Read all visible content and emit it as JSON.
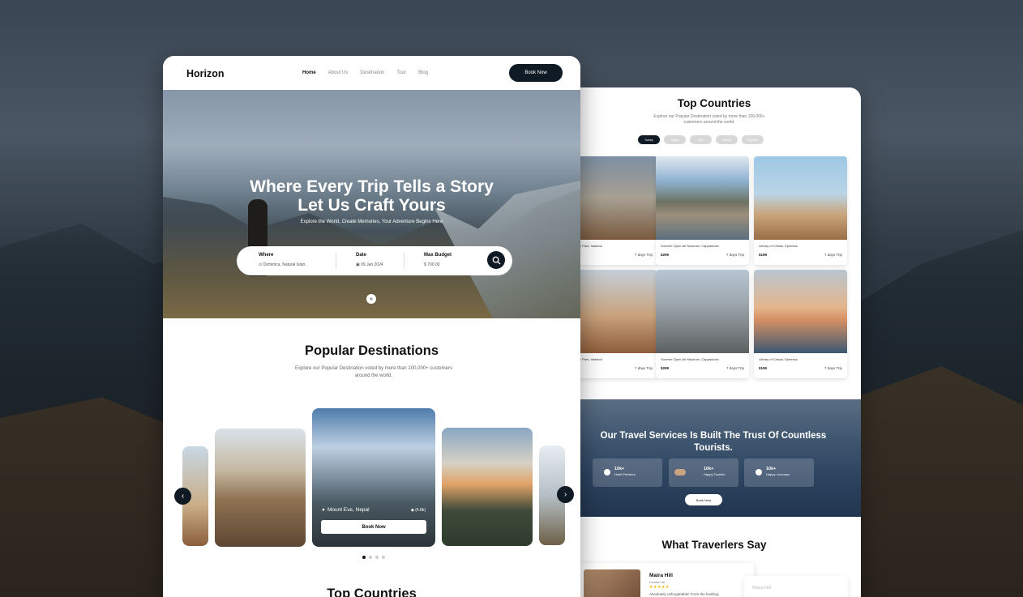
{
  "nav": {
    "logo": "Horizon",
    "links": [
      "Home",
      "About Us",
      "Destination",
      "Tour",
      "Blog"
    ],
    "cta": "Book Now"
  },
  "hero": {
    "title_line1": "Where Every Trip Tells a Story",
    "title_line2": "Let Us Craft Yours",
    "subtitle": "Explore the World, Create Memories, Your Adventure Begins Here",
    "search": {
      "where_label": "Where",
      "where_value": "Dominica, Natural Islan..",
      "date_label": "Date",
      "date_value": "09 Jan 2024",
      "budget_label": "Max Budget",
      "budget_value": "700.00",
      "currency": "$"
    }
  },
  "popular": {
    "title": "Popular Destinations",
    "subtitle": "Explore our Popular Destination voted by more than 100,000+ customers around the world.",
    "featured": {
      "location": "Mount Eve, Nepal",
      "rating": "(4.8k)",
      "button": "Book Now"
    }
  },
  "top_countries_heading": "Top Countries",
  "right": {
    "title": "Top Countries",
    "subtitle": "Explore our Popular Destination voted by more than 100,000+ customers around the world.",
    "tabs": [
      "Turkey",
      "Spain",
      "Italy",
      "France",
      "England"
    ],
    "cards": [
      {
        "name": "Gulhane Park, Istanbul",
        "price": "",
        "days": "7 days Trip"
      },
      {
        "name": "Goreme Open-Air Museum, Cappadocia",
        "price": "$299",
        "days": "7 days Trip"
      },
      {
        "name": "Library of Celsus, Ephesus",
        "price": "$199",
        "days": "7 days Trip"
      },
      {
        "name": "Gulhane Park, Istanbul",
        "price": "",
        "days": "7 days Trip"
      },
      {
        "name": "Goreme Open-Air Museum, Cappadocia",
        "price": "$299",
        "days": "7 days Trip"
      },
      {
        "name": "Library of Celsus, Ephesus",
        "price": "$199",
        "days": "7 days Trip"
      }
    ],
    "band": {
      "headline": "Our Travel Services Is Built The Trust Of Countless Tourists.",
      "stats": [
        {
          "num": "10k+",
          "label": "Hotel Partners"
        },
        {
          "num": "10k+",
          "label": "Happy Tourists"
        },
        {
          "num": "10k+",
          "label": "Happy Journeys"
        }
      ],
      "button": "Book Now"
    },
    "testimonials_title": "What Traverlers Say",
    "testimonial": {
      "name": "Maira Hill",
      "location": "London Uk",
      "stars": "★★★★★",
      "quote": "Absolutely unforgettable! From the bustling"
    },
    "testimonial2_name": "Maira Hill"
  }
}
